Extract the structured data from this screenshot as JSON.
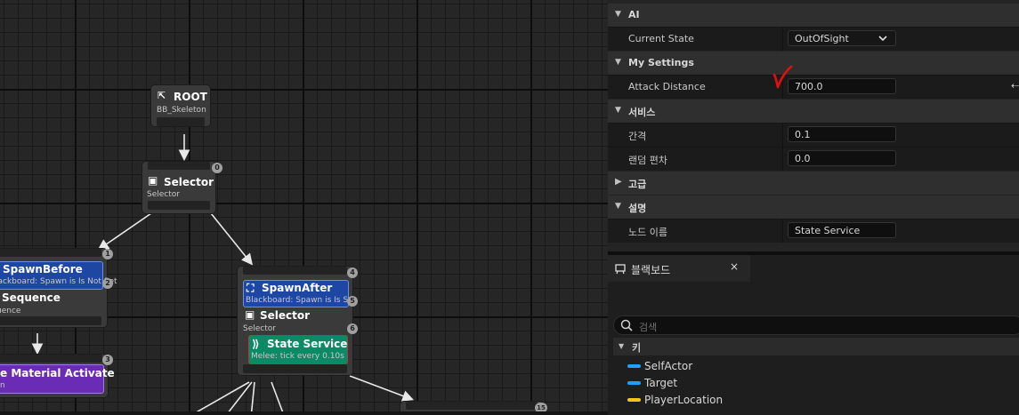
{
  "graph": {
    "root": {
      "title": "ROOT",
      "subtitle": "BB_Skeleton"
    },
    "selector_main": {
      "title": "Selector",
      "subtitle": "Selector",
      "badge": "0"
    },
    "left_branch": {
      "decorator": {
        "title": "SpawnBefore",
        "subtitle": "lackboard: Spawn is Is Not Set",
        "badge": "2"
      },
      "composite": {
        "title": "Sequence",
        "subtitle": "uence"
      },
      "top_badge": "1"
    },
    "right_branch": {
      "decorator": {
        "title": "SpawnAfter",
        "subtitle": "Blackboard: Spawn is Is Set",
        "badge": "5"
      },
      "composite": {
        "title": "Selector",
        "subtitle": "Selector",
        "badge": "6"
      },
      "service": {
        "title": "State Service",
        "subtitle": "Melee: tick every 0.10s"
      },
      "top_badge": "4"
    },
    "task_node": {
      "title": "e Material Activate",
      "subtitle": "n",
      "badge": "3"
    },
    "bottom_badge": "15",
    "colors": {
      "decorator": "#1d47a3",
      "service": "#0c8a66",
      "task": "#6b2cb5",
      "wire": "#e8e8e8"
    }
  },
  "details": {
    "sections": [
      {
        "label": "AI",
        "props": [
          {
            "label": "Current State",
            "value": "OutOfSight",
            "type": "combo"
          }
        ]
      },
      {
        "label": "My Settings",
        "props": [
          {
            "label": "Attack Distance",
            "value": "700.0",
            "type": "number"
          }
        ]
      },
      {
        "label": "서비스",
        "props": [
          {
            "label": "간격",
            "value": "0.1",
            "type": "number"
          },
          {
            "label": "랜덤 편차",
            "value": "0.0",
            "type": "number"
          }
        ]
      },
      {
        "label": "고급",
        "props": []
      },
      {
        "label": "설명",
        "props": [
          {
            "label": "노드 이름",
            "value": "State Service",
            "type": "text"
          }
        ]
      }
    ],
    "annotation_color": "#e01010"
  },
  "blackboard": {
    "tab_label": "블랙보드",
    "close_glyph": "×",
    "search_placeholder": "검색",
    "keys_label": "키",
    "keys": [
      {
        "label": "SelfActor",
        "color": "#1ea0ff"
      },
      {
        "label": "Target",
        "color": "#1ea0ff"
      },
      {
        "label": "PlayerLocation",
        "color": "#f5c518"
      }
    ]
  }
}
